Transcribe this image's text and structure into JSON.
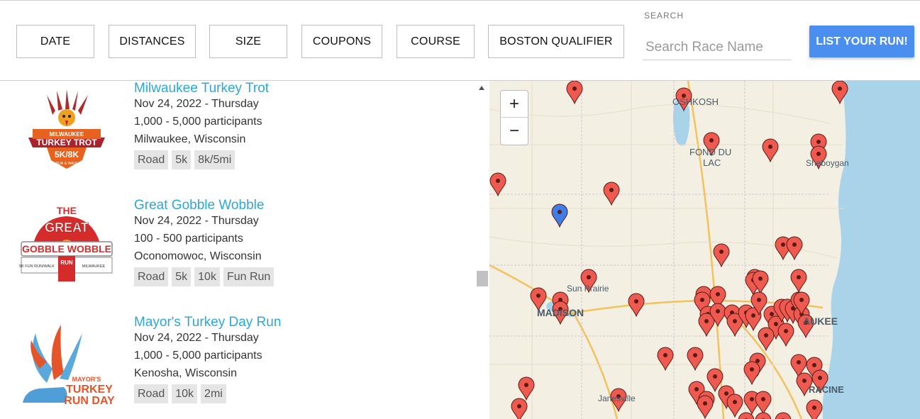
{
  "filters": [
    {
      "label": "DATE"
    },
    {
      "label": "DISTANCES"
    },
    {
      "label": "SIZE"
    },
    {
      "label": "COUPONS"
    },
    {
      "label": "COURSE"
    },
    {
      "label": "BOSTON QUALIFIER"
    }
  ],
  "search": {
    "label": "SEARCH",
    "placeholder": "Search Race Name",
    "value": ""
  },
  "cta": {
    "label": "LIST YOUR RUN!"
  },
  "races": [
    {
      "title": "Milwaukee Turkey Trot",
      "date": "Nov 24, 2022 - Thursday",
      "size": "1,000 - 5,000 participants",
      "location": "Milwaukee, Wisconsin",
      "tags": [
        "Road",
        "5k",
        "8k/5mi"
      ],
      "logo": {
        "line1": "MILWAUKEE",
        "line2": "TURKEY TROT",
        "line3": "5K/8K",
        "line4": "RUN & WALK"
      }
    },
    {
      "title": "Great Gobble Wobble",
      "date": "Nov 24, 2022 - Thursday",
      "size": "100 - 500 participants",
      "location": "Oconomowoc, Wisconsin",
      "tags": [
        "Road",
        "5k",
        "10k",
        "Fun Run"
      ],
      "logo": {
        "line1": "THE",
        "line2": "GREAT",
        "line3": "GOBBLE WOBBLE",
        "line4": "5K FUN RUN/WALK",
        "line5": "RUN",
        "line6": "MILWAUKEE"
      }
    },
    {
      "title": "Mayor's Turkey Day Run",
      "date": "Nov 24, 2022 - Thursday",
      "size": "1,000 - 5,000 participants",
      "location": "Kenosha, Wisconsin",
      "tags": [
        "Road",
        "10k",
        "2mi"
      ],
      "logo": {
        "line1": "MAYOR'S",
        "line2": "TURKEY",
        "line3": "RUN DAY"
      }
    }
  ],
  "map": {
    "zoom_in": "+",
    "zoom_out": "−",
    "places": [
      "OSHKOSH",
      "FOND DU",
      "LAC",
      "Sheboygan",
      "Sun Prairie",
      "MADISON",
      "AUKEE",
      "RACINE",
      "Janesville"
    ],
    "marker_color": "#ef5a50",
    "selected_marker_color": "#3f7ee8",
    "lake_color": "#a9d3e8"
  }
}
